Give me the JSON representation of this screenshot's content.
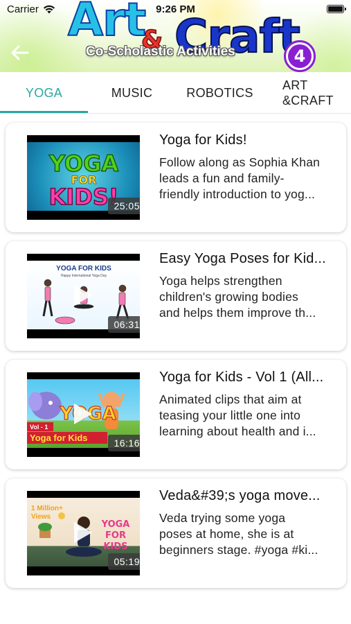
{
  "status_bar": {
    "carrier": "Carrier",
    "time": "9:26 PM"
  },
  "header": {
    "logo_word_1": "Art",
    "logo_ampersand": "&",
    "logo_word_2": "Craft",
    "subtitle": "Co-Scholastic Activities",
    "grade_badge": "4",
    "back_icon": "arrow-left-icon"
  },
  "tabs": [
    {
      "label": "YOGA",
      "active": true
    },
    {
      "label": "MUSIC",
      "active": false
    },
    {
      "label": "ROBOTICS",
      "active": false
    },
    {
      "label": "ART\n&CRAFT",
      "active": false
    }
  ],
  "videos": [
    {
      "title": "Yoga for Kids!",
      "description_lines": [
        "Follow along as Sophia Khan",
        "leads a fun and family-",
        "friendly introduction to yog..."
      ],
      "duration": "25:05",
      "thumb_text": [
        "YOGA",
        "FOR",
        "KIDS!"
      ]
    },
    {
      "title": "Easy Yoga Poses for Kid...",
      "description_lines": [
        "Yoga helps strengthen",
        "children's growing bodies",
        "and helps them improve th..."
      ],
      "duration": "06:31",
      "thumb_text": [
        "YOGA FOR KIDS",
        "Happy International Yoga Day"
      ]
    },
    {
      "title": "Yoga for Kids - Vol 1 (All...",
      "description_lines": [
        "Animated clips that aim at",
        "teasing your little one into",
        "learning about health and i..."
      ],
      "duration": "16:16",
      "thumb_text": [
        "Vol - 1",
        "Yoga for Kids",
        "YOGA"
      ]
    },
    {
      "title": "Veda&#39;s yoga move...",
      "description_lines": [
        "Veda trying some yoga",
        "poses at home, she is at",
        "beginners stage. #yoga #ki..."
      ],
      "duration": "05:19",
      "thumb_text": [
        "1 Million+",
        "Views",
        "YOGA",
        "FOR",
        "KIDS"
      ]
    }
  ],
  "colors": {
    "accent": "#2aa7a3",
    "badge": "#8a1fd1"
  }
}
